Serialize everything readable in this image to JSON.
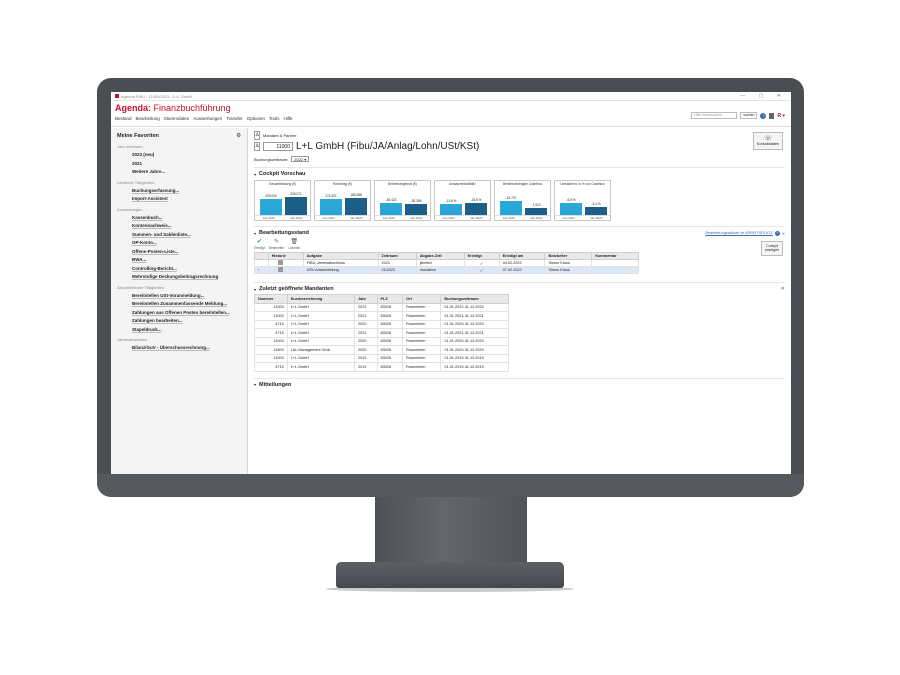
{
  "window": {
    "title": "Agenda FIBU · 11000/2023 - L+L GmbH"
  },
  "app": {
    "brand": "Agenda:",
    "module": "Finanzbuchführung"
  },
  "menu": [
    "Bestand",
    "Bearbeitung",
    "Stammdaten",
    "Auswertungen",
    "Transfer",
    "Optionen",
    "Tools",
    "Hilfe"
  ],
  "header": {
    "search_placeholder": "Hilfe durchsuchen",
    "search_button": "suchen"
  },
  "sidebar": {
    "title": "Meine Favoriten",
    "groups": [
      {
        "label": "Jahr wechseln",
        "items": [
          "2023 (neu)",
          "2021",
          "Weitere Jahre..."
        ]
      },
      {
        "label": "Laufende Tätigkeiten",
        "items": [
          "Buchungserfassung...",
          "Import-Assistent"
        ]
      },
      {
        "label": "Auswertungen",
        "items": [
          "Kassenbuch...",
          "Kontennachweis...",
          "Summen- und Saldenliste...",
          "OP-Konto...",
          "Offene-Posten-Liste...",
          "BWA...",
          "Controlling-Bericht...",
          "Mehrstufige Deckungsbeitragsrechnung"
        ]
      },
      {
        "label": "Abschließende Tätigkeiten",
        "items": [
          "Bereitstellen USt-Voranmeldung...",
          "Bereitstellen Zusammenfassende Meldung...",
          "Zahlungen aus Offenen Posten bereitstellen...",
          "Zahlungen bearbeiten...",
          "Stapeldruck..."
        ]
      },
      {
        "label": "Jahresabschluss",
        "items": [
          "Bilanz/GuV - Überschussrechnung..."
        ]
      }
    ]
  },
  "client": {
    "label": "Mandant & Partner",
    "number": "11000",
    "name": "L+L GmbH (Fibu/JA/Anlag/Lohn/USt/KSt)",
    "period_label": "Buchungszeitraum:",
    "period": "2022"
  },
  "contact_button": "Kontaktdaten",
  "cockpit": {
    "title": "Cockpit Vorschau",
    "button": "Cockpit anzeigen",
    "colors": {
      "bar": "#2aa6d9",
      "bar_dark": "#1c5f86"
    },
    "tiles": [
      {
        "title": "Gesamtleistung (€)",
        "left_value": "209.000",
        "right_value": "225.071",
        "left_pct": 0.82,
        "right_pct": 0.88,
        "left_period": "Jan 2021",
        "right_period": "Jan 2022"
      },
      {
        "title": "Rohertrag (€)",
        "left_value": "174.321",
        "right_value": "185.088",
        "left_pct": 0.8,
        "right_pct": 0.86,
        "left_period": "Jan 2021",
        "right_period": "Jan 2022"
      },
      {
        "title": "Betriebsergebnis (€)",
        "left_value": "-36.423",
        "right_value": "-35.306",
        "left_pct": 0.6,
        "right_pct": 0.55,
        "left_period": "Jan 2021",
        "right_period": "Jan 2022"
      },
      {
        "title": "Umsatzrentabilität I",
        "left_value": "-13,6 %",
        "right_value": "-15,9 %",
        "left_pct": 0.55,
        "right_pct": 0.62,
        "left_period": "Jan 2021",
        "right_period": "Jan 2022"
      },
      {
        "title": "Betriebsbedingter Cashflow",
        "left_value": "-15.707",
        "right_value": "-7.012",
        "left_pct": 0.68,
        "right_pct": 0.35,
        "left_period": "Jan 2021",
        "right_period": "Jan 2022"
      },
      {
        "title": "Umsatzrent. in % von Cashflow",
        "left_value": "-6,5 %",
        "right_value": "-3,4 %",
        "left_pct": 0.62,
        "right_pct": 0.38,
        "left_period": "Jan 2021",
        "right_period": "Jan 2022"
      }
    ]
  },
  "bearbeitungsstand": {
    "title": "Bearbeitungsstand",
    "link": "Bearbeitungsstände im ARBEITSPLATZ",
    "toolbar": [
      "Erledigt",
      "Bearbeiten",
      "Löschen"
    ],
    "columns": [
      "Historie",
      "Aufgabe",
      "Zeitraum",
      "Abgabe-Zeit",
      "Erledigt",
      "Erledigt am",
      "Bearbeiter",
      "Kommentar"
    ],
    "rows": [
      {
        "aufgabe": "FIBU-Jahresabschluss",
        "zeitraum": "2021",
        "abgabe": "jährlich",
        "erledigt": "✓",
        "erledigt_am": "04.02.2022",
        "bearbeiter": "Simon Klaus",
        "kommentar": ""
      },
      {
        "aufgabe": "USt-Voranmeldung",
        "zeitraum": "01/2022",
        "abgabe": "monatlich",
        "erledigt": "✓",
        "erledigt_am": "07.02.2022",
        "bearbeiter": "Simon Klaus",
        "kommentar": ""
      }
    ]
  },
  "mandanten": {
    "title": "Zuletzt geöffnete Mandanten",
    "columns": [
      "Nummer",
      "Kurzbezeichnung",
      "Jahr",
      "PLZ",
      "Ort",
      "Buchungszeitraum"
    ],
    "rows": [
      [
        "11000",
        "L+L GmbH",
        "2022",
        "83026",
        "Rosenheim",
        "01.01.2022-31.12.2022"
      ],
      [
        "11000",
        "L+L GmbH",
        "2021",
        "83026",
        "Rosenheim",
        "01.01.2021-31.12.2021"
      ],
      [
        "4715",
        "L+L GmbH",
        "2020",
        "83026",
        "Rosenheim",
        "01.01.2020-31.12.2020"
      ],
      [
        "4715",
        "L+L GmbH",
        "2021",
        "83026",
        "Rosenheim",
        "01.01.2021-31.12.2021"
      ],
      [
        "11000",
        "L+L GmbH",
        "2020",
        "83026",
        "Rosenheim",
        "01.01.2020-31.12.2020"
      ],
      [
        "11500",
        "L&L Management Gmb",
        "2020",
        "83026",
        "Rosenheim",
        "01.01.2020-31.12.2020"
      ],
      [
        "11000",
        "L+L GmbH",
        "2019",
        "83026",
        "Rosenheim",
        "01.01.2019-31.12.2019"
      ],
      [
        "4715",
        "L+L GmbH",
        "2019",
        "83026",
        "Rosenheim",
        "01.01.2019-31.12.2019"
      ]
    ]
  },
  "mitteilungen": {
    "title": "Mitteilungen"
  }
}
